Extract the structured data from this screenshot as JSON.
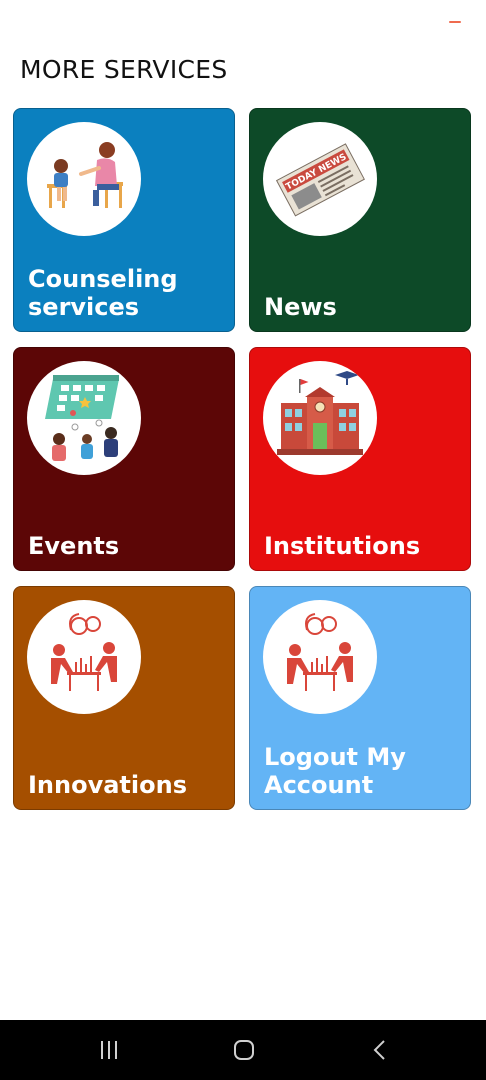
{
  "page": {
    "title": "MORE SERVICES"
  },
  "cards": [
    {
      "label": "Counseling services",
      "color": "#0b80bf",
      "icon": "counseling-illustration"
    },
    {
      "label": "News",
      "color": "#0d4a28",
      "icon": "newspaper-illustration",
      "icon_text": "TODAY NEWS"
    },
    {
      "label": "Events",
      "color": "#5c0606",
      "icon": "events-calendar-illustration"
    },
    {
      "label": "Institutions",
      "color": "#e60e0e",
      "icon": "school-building-illustration"
    },
    {
      "label": "Innovations",
      "color": "#a54f00",
      "icon": "innovation-team-illustration"
    },
    {
      "label": "Logout My Account",
      "color": "#63b4f5",
      "icon": "innovation-team-illustration"
    }
  ],
  "navbar": {
    "buttons": [
      "recent-apps-icon",
      "home-icon",
      "back-icon"
    ]
  }
}
